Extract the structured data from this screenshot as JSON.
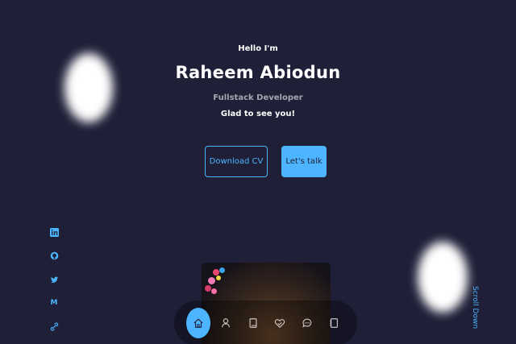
{
  "hero": {
    "greeting": "Hello I'm",
    "name": "Raheem Abiodun",
    "role": "Fullstack Developer",
    "tagline": "Glad to see you!"
  },
  "buttons": {
    "download_cv": "Download CV",
    "lets_talk": "Let's talk"
  },
  "socials": [
    {
      "icon": "linkedin-icon"
    },
    {
      "icon": "github-icon"
    },
    {
      "icon": "twitter-icon"
    },
    {
      "icon": "medium-icon",
      "glyph": "M"
    },
    {
      "icon": "link-icon"
    }
  ],
  "scroll_label": "Scroll Down",
  "nav": [
    {
      "icon": "home-icon",
      "active": true
    },
    {
      "icon": "user-icon"
    },
    {
      "icon": "book-icon"
    },
    {
      "icon": "services-icon"
    },
    {
      "icon": "message-icon"
    },
    {
      "icon": "contact-icon"
    }
  ],
  "colors": {
    "background": "#1f1f38",
    "accent": "#4db5ff",
    "text": "#ffffff"
  }
}
